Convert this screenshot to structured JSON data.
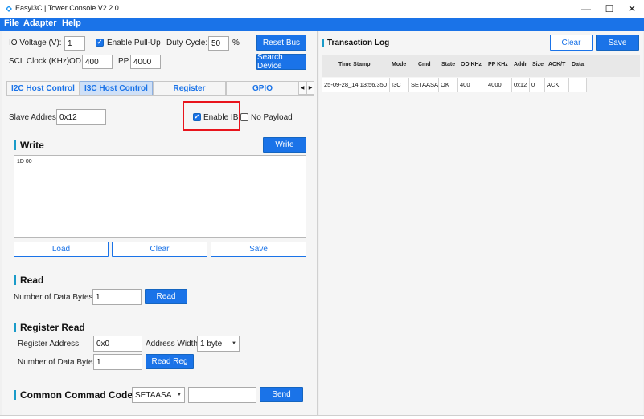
{
  "window": {
    "title": "Easyi3C | Tower Console V2.2.0",
    "controls": {
      "minimize": "—",
      "maximize": "☐",
      "close": "✕"
    }
  },
  "menu": {
    "file": "File",
    "adapter": "Adapter",
    "help": "Help"
  },
  "settings": {
    "io_voltage_label": "IO Voltage (V):",
    "io_voltage_value": "1",
    "enable_pullup_label": "Enable Pull-Up",
    "duty_cycle_label": "Duty Cycle:",
    "duty_cycle_value": "50",
    "duty_cycle_unit": "%",
    "reset_bus_label": "Reset Bus",
    "scl_clock_label": "SCL Clock (KHz):",
    "od_label": "OD",
    "od_value": "400",
    "pp_label": "PP",
    "pp_value": "4000",
    "search_device_label": "Search Device"
  },
  "tabs": {
    "i2c": "I2C Host Control",
    "i3c": "I3C Host Control",
    "register": "Register",
    "gpio": "GPIO",
    "scroll_left": "◀",
    "scroll_right": "▶"
  },
  "i3c_panel": {
    "slave_address_label": "Slave Address",
    "slave_address_value": "0x12",
    "enable_ibi_label": "Enable IBI",
    "no_payload_label": "No Payload",
    "write_title": "Write",
    "write_button": "Write",
    "write_data": "1D 00",
    "load_button": "Load",
    "clear_button": "Clear",
    "save_button": "Save",
    "read_title": "Read",
    "num_bytes_label": "Number of Data Bytes",
    "num_bytes_value": "1",
    "read_button": "Read",
    "register_read_title": "Register Read",
    "register_address_label": "Register Address",
    "register_address_value": "0x0",
    "address_width_label": "Address Width",
    "address_width_value": "1 byte",
    "reg_num_bytes_label": "Number of Data Bytes",
    "reg_num_bytes_value": "1",
    "read_reg_button": "Read Reg",
    "ccc_title": "Common Commad Code",
    "ccc_value": "SETAASA",
    "ccc_input_value": "",
    "send_button": "Send"
  },
  "transaction_log": {
    "title": "Transaction Log",
    "clear_button": "Clear",
    "save_button": "Save",
    "columns": [
      "Time Stamp",
      "Mode",
      "Cmd",
      "State",
      "OD KHz",
      "PP KHz",
      "Addr",
      "Size",
      "ACK/T",
      "Data"
    ],
    "rows": [
      [
        "25-09-28_14:13:56.350",
        "I3C",
        "SETAASA",
        "OK",
        "400",
        "4000",
        "0x12",
        "0",
        "ACK",
        ""
      ]
    ]
  },
  "colors": {
    "accent": "#1a73e8",
    "highlight_box": "#e8141c",
    "section_bar": "#1a9bc9"
  }
}
